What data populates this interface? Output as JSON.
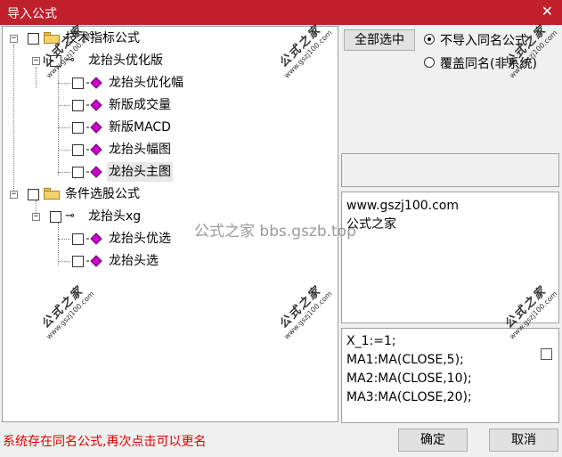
{
  "window": {
    "title": "导入公式",
    "close_glyph": "✕"
  },
  "tree": {
    "nodes": [
      {
        "label": "技术指标公式"
      },
      {
        "label": "龙抬头优化版"
      },
      {
        "label": "龙抬头优化幅"
      },
      {
        "label": "新版成交量"
      },
      {
        "label": "新版MACD"
      },
      {
        "label": "龙抬头幅图"
      },
      {
        "label": "龙抬头主图"
      },
      {
        "label": "条件选股公式"
      },
      {
        "label": "龙抬头xg"
      },
      {
        "label": "龙抬头优选"
      },
      {
        "label": "龙抬头选"
      }
    ],
    "expander_glyph": "−"
  },
  "buttons": {
    "select_all": "全部选中",
    "ok": "确定",
    "cancel": "取消"
  },
  "options": {
    "no_import_same": "不导入同名公式",
    "overwrite_same": "覆盖同名(非系统)",
    "selected": "no_import_same"
  },
  "description_lines": [
    "www.gszj100.com",
    "公式之家"
  ],
  "code_lines": [
    "X_1:=1;",
    "MA1:MA(CLOSE,5);",
    "MA2:MA(CLOSE,10);",
    "MA3:MA(CLOSE,20);"
  ],
  "watermark": {
    "big": "公式之家",
    "small": "www.gszj100.com",
    "overlay": "公式之家 bbs.gszb.top"
  },
  "status_text": "系统存在同名公式,再次点击可以更名",
  "colors": {
    "titlebar": "#c0202c",
    "status": "#e00000",
    "diamond": "#cc00cc"
  }
}
